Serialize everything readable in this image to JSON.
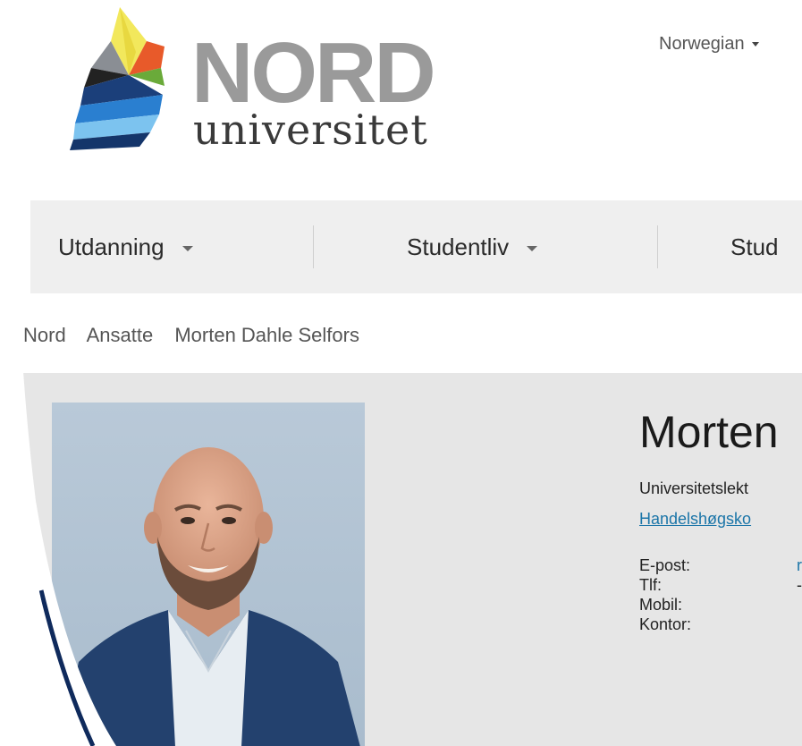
{
  "logo": {
    "word": "NORD",
    "sub": "universitet"
  },
  "language": {
    "label": "Norwegian"
  },
  "nav": {
    "items": [
      {
        "label": "Utdanning"
      },
      {
        "label": "Studentliv"
      },
      {
        "label": "Stud"
      }
    ]
  },
  "breadcrumb": {
    "items": [
      "Nord",
      "Ansatte",
      "Morten Dahle Selfors"
    ]
  },
  "profile": {
    "name": "Morten",
    "title": "Universitetslekt",
    "department": "Handelshøgsko",
    "contact": [
      {
        "label": "E-post:",
        "value": "r"
      },
      {
        "label": "Tlf:",
        "value": "-"
      },
      {
        "label": "Mobil:",
        "value": ""
      },
      {
        "label": "Kontor:",
        "value": ""
      }
    ]
  },
  "colors": {
    "nav_bg": "#efefef",
    "profile_bg": "#e6e6e6",
    "link": "#1b75a8",
    "logo_gray": "#9a9a9a"
  }
}
